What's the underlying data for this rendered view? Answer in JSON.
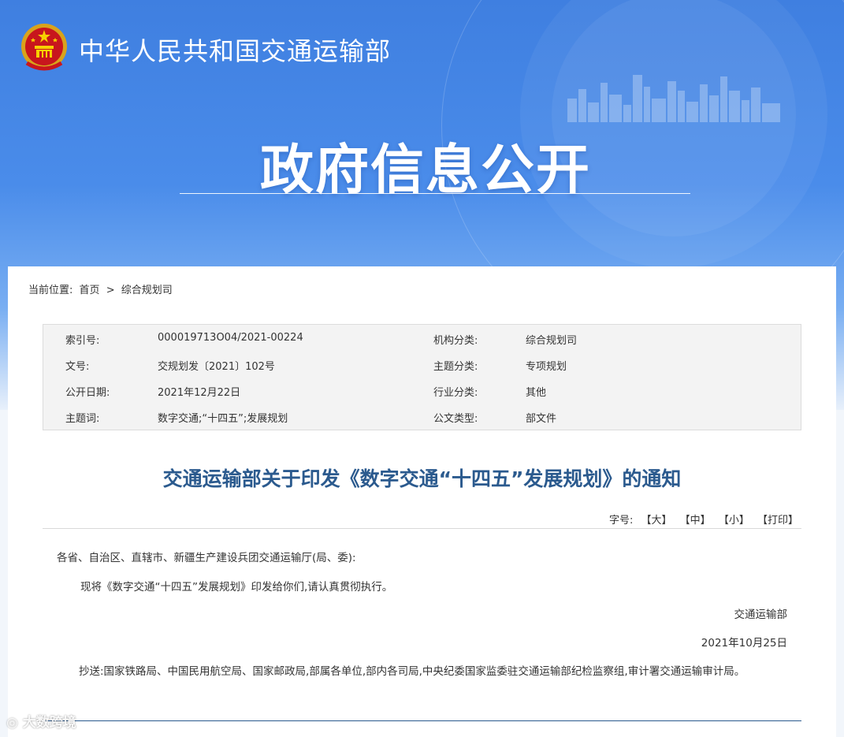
{
  "header": {
    "ministry_name": "中华人民共和国交通运输部",
    "portal_title": "政府信息公开"
  },
  "breadcrumb": {
    "label": "当前位置:",
    "home": "首页",
    "separator": ">",
    "current": "综合规划司"
  },
  "meta": {
    "rows": [
      {
        "k1": "索引号:",
        "v1": "000019713O04/2021-00224",
        "k2": "机构分类:",
        "v2": "综合规划司"
      },
      {
        "k1": "文号:",
        "v1": "交规划发〔2021〕102号",
        "k2": "主题分类:",
        "v2": "专项规划"
      },
      {
        "k1": "公开日期:",
        "v1": "2021年12月22日",
        "k2": "行业分类:",
        "v2": "其他"
      },
      {
        "k1": "主题词:",
        "v1": "数字交通;“十四五”;发展规划",
        "k2": "公文类型:",
        "v2": "部文件"
      }
    ]
  },
  "document": {
    "title": "交通运输部关于印发《数字交通“十四五”发展规划》的通知",
    "font_size_label": "字号:",
    "font_large": "【大】",
    "font_medium": "【中】",
    "font_small": "【小】",
    "print": "【打印】",
    "addressee": "各省、自治区、直辖市、新疆生产建设兵团交通运输厅(局、委):",
    "paragraph": "现将《数字交通“十四五”发展规划》印发给你们,请认真贯彻执行。",
    "signer": "交通运输部",
    "date": "2021年10月25日",
    "cc": "抄送:国家铁路局、中国民用航空局、国家邮政局,部属各单位,部内各司局,中央纪委国家监委驻交通运输部纪检监察组,审计署交通运输审计局。"
  },
  "watermark": "大数跨境",
  "colors": {
    "banner_blue": "#4a8cea",
    "title_blue": "#2b5a8e",
    "meta_bg": "#f3f3f3"
  },
  "icons": {
    "emblem": "national-emblem-icon"
  }
}
